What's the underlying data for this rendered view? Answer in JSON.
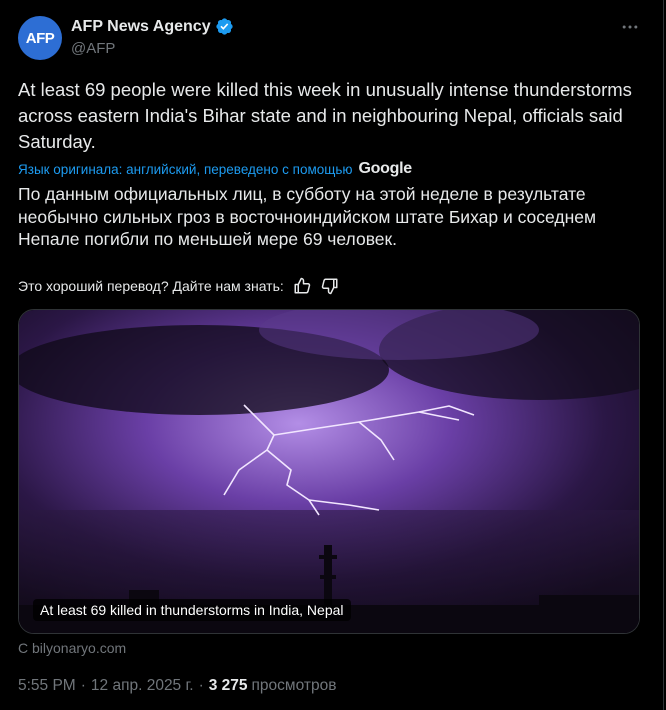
{
  "account": {
    "avatar_text": "AFP",
    "name": "AFP News Agency",
    "handle": "@AFP",
    "verified": true,
    "more_icon": "more-horizontal-icon"
  },
  "tweet": {
    "text": "At least 69 people were killed this week in unusually intense thunderstorms across eastern India's Bihar state and in neighbouring Nepal, officials said Saturday.",
    "translation_info": "Язык оригинала: английский, переведено с помощью",
    "translation_provider": "Google",
    "translated_text": "По данным официальных лиц, в субботу на этой неделе в результате необычно сильных гроз в восточноиндийском штате Бихар и соседнем Непале погибли по меньшей мере 69 человек.",
    "feedback_prompt": "Это хороший перевод? Дайте нам знать:"
  },
  "media": {
    "caption": "At least 69 killed in thunderstorms in India, Nepal",
    "source": "С bilyonaryo.com"
  },
  "meta": {
    "time": "5:55 PM",
    "date": "12 апр. 2025 г.",
    "views_count": "3 275",
    "views_label": "просмотров"
  },
  "colors": {
    "background": "#000000",
    "text": "#e7e9ea",
    "muted": "#71767b",
    "link": "#1d9bf0",
    "avatar": "#2d6ed4",
    "verified_badge": "#1d9bf0"
  }
}
